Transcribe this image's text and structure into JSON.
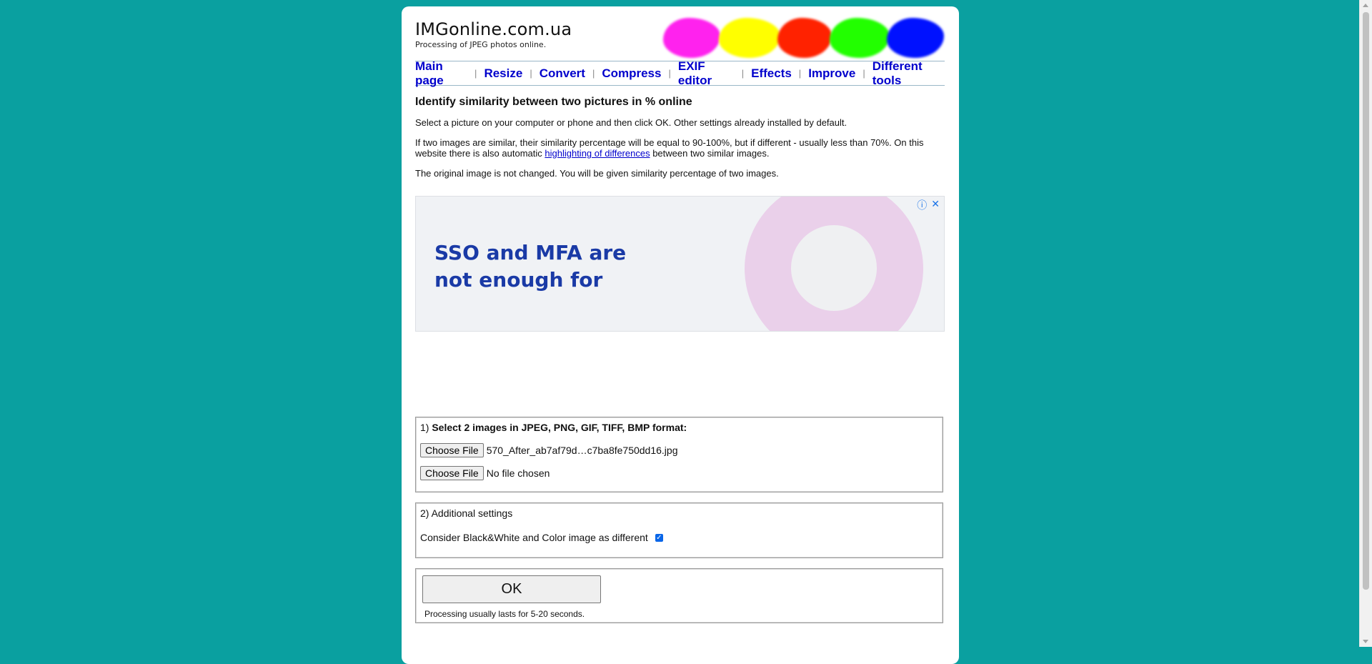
{
  "header": {
    "site_title": "IMGonline.com.ua",
    "site_subtitle": "Processing of JPEG photos online.",
    "splash_colors": [
      "#ff22ee",
      "#ffff00",
      "#ff2200",
      "#22ff00",
      "#0011ff"
    ]
  },
  "nav": {
    "items": [
      "Main page",
      "Resize",
      "Convert",
      "Compress",
      "EXIF editor",
      "Effects",
      "Improve",
      "Different tools"
    ],
    "separator": "|"
  },
  "content": {
    "heading": "Identify similarity between two pictures in % online",
    "para1": "Select a picture on your computer or phone and then click OK. Other settings already installed by default.",
    "para2_before": "If two images are similar, their similarity percentage will be equal to 90-100%, but if different - usually less than 70%. On this website there is also automatic ",
    "para2_link": "highlighting of differences",
    "para2_after": " between two similar images.",
    "para3": "The original image is not changed. You will be given similarity percentage of two images."
  },
  "ad": {
    "headline": "SSO and MFA are not enough for",
    "info_icon": "ⓘ",
    "close_icon": "✕"
  },
  "form": {
    "step1_prefix": "1) ",
    "step1_title": "Select 2 images in JPEG, PNG, GIF, TIFF, BMP format:",
    "choose_file_label": "Choose File",
    "file1_name": "570_After_ab7af79d…c7ba8fe750dd16.jpg",
    "file2_name": "No file chosen",
    "step2_title": "2) Additional settings",
    "checkbox_label": "Consider Black&White and Color image as different",
    "checkbox_checked": true,
    "ok_label": "OK",
    "processing_note": "Processing usually lasts for 5-20 seconds."
  }
}
